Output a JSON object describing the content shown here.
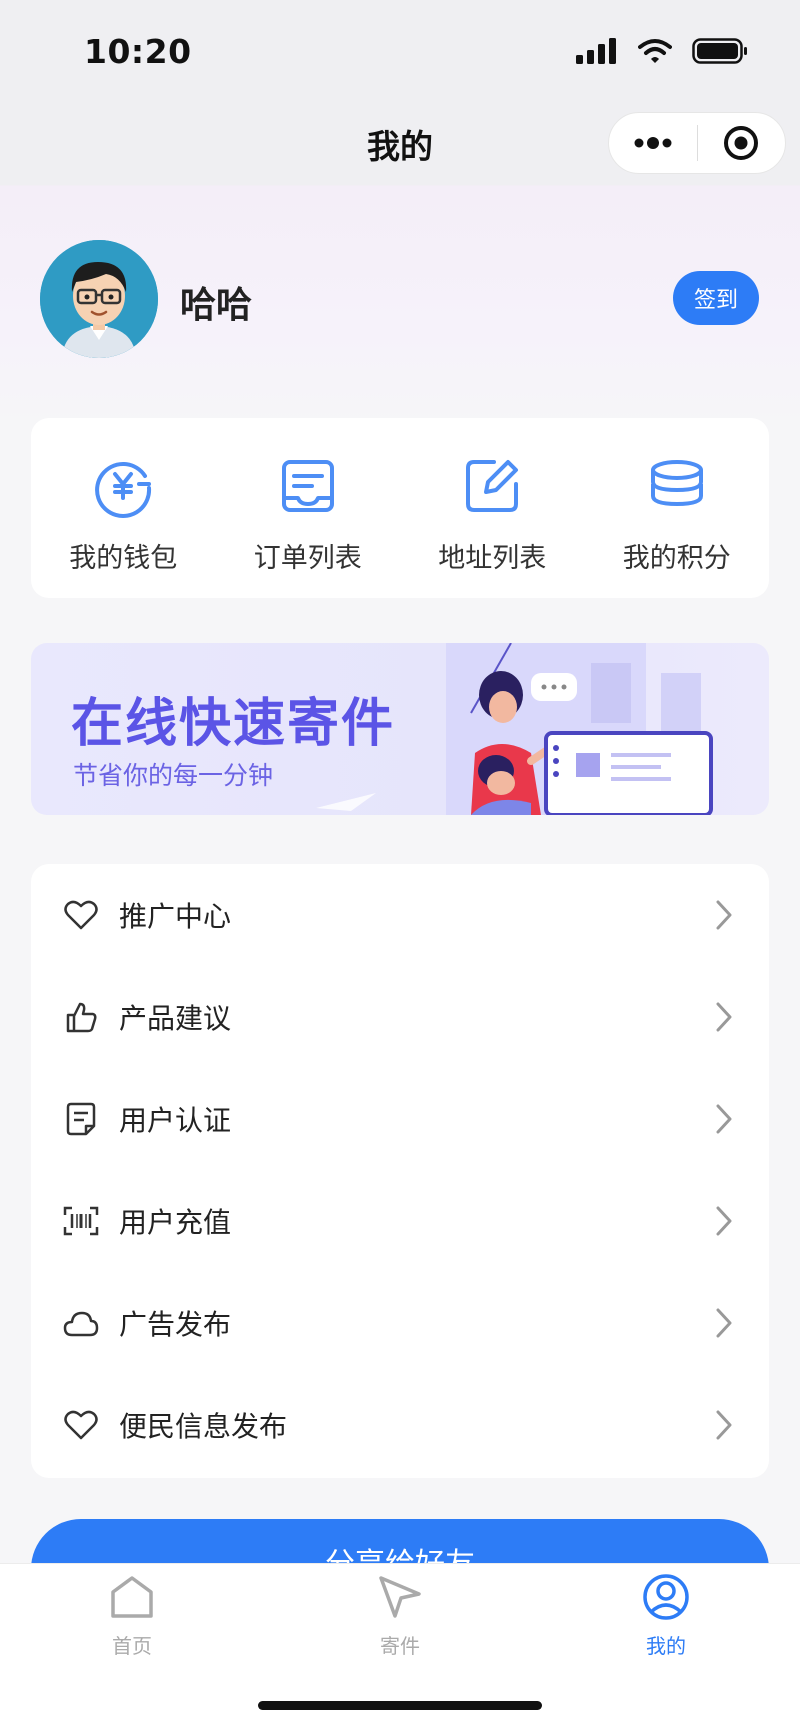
{
  "status_bar": {
    "time": "10:20"
  },
  "nav": {
    "title": "我的"
  },
  "profile": {
    "name": "哈哈",
    "signin_label": "签到"
  },
  "quick_actions": [
    {
      "label": "我的钱包",
      "icon": "wallet-yen-icon"
    },
    {
      "label": "订单列表",
      "icon": "order-list-icon"
    },
    {
      "label": "地址列表",
      "icon": "edit-address-icon"
    },
    {
      "label": "我的积分",
      "icon": "points-coins-icon"
    }
  ],
  "banner": {
    "title": "在线快速寄件",
    "subtitle": "节省你的每一分钟"
  },
  "menu": [
    {
      "label": "推广中心",
      "icon": "heart-icon"
    },
    {
      "label": "产品建议",
      "icon": "thumbs-up-icon"
    },
    {
      "label": "用户认证",
      "icon": "document-icon"
    },
    {
      "label": "用户充值",
      "icon": "barcode-scan-icon"
    },
    {
      "label": "广告发布",
      "icon": "cloud-icon"
    },
    {
      "label": "便民信息发布",
      "icon": "heart-icon"
    }
  ],
  "share_button": {
    "label": "分享给好友"
  },
  "tab_bar": [
    {
      "label": "首页",
      "icon": "home-icon",
      "active": false
    },
    {
      "label": "寄件",
      "icon": "send-icon",
      "active": false
    },
    {
      "label": "我的",
      "icon": "user-icon",
      "active": true
    }
  ],
  "colors": {
    "accent": "#2d7cf6",
    "banner_text": "#5b54e6",
    "icon_blue": "#4d8ef5"
  }
}
